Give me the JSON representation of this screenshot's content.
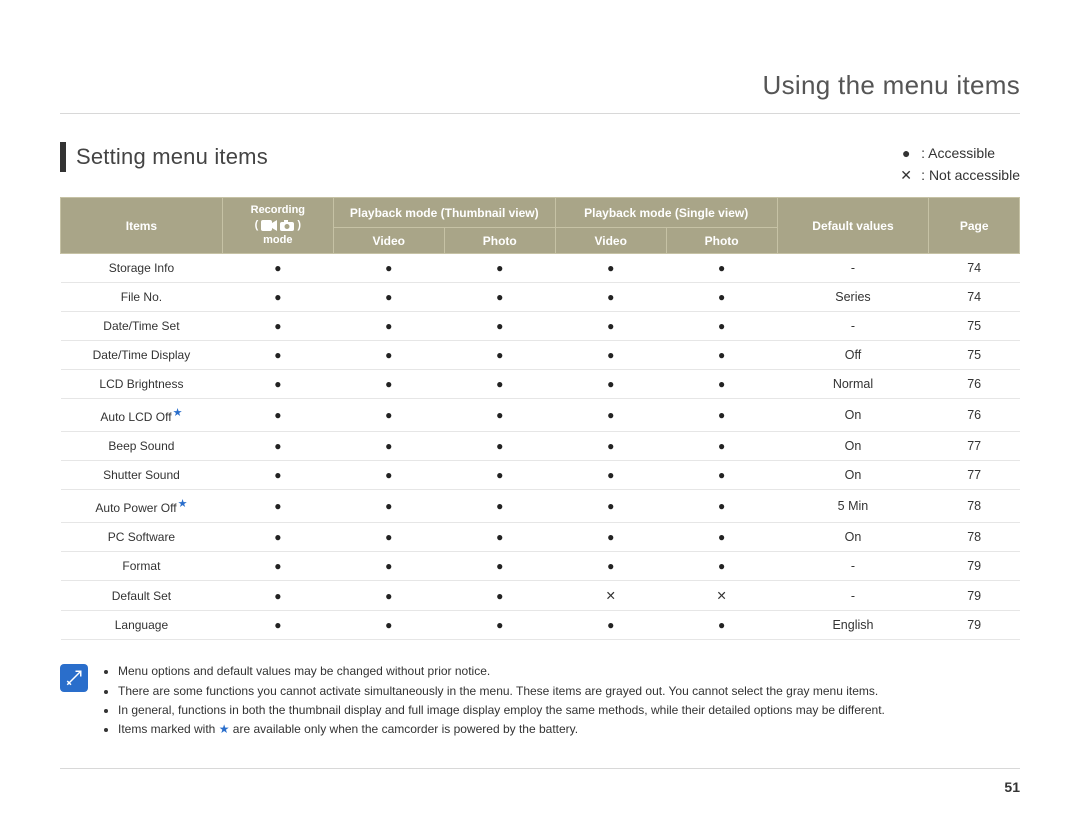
{
  "chapter_title": "Using the menu items",
  "section_title": "Setting menu items",
  "legend": {
    "accessible_symbol": "●",
    "accessible_label": ": Accessible",
    "not_accessible_symbol": "✕",
    "not_accessible_label": ": Not accessible"
  },
  "table": {
    "headers": {
      "items": "Items",
      "recording_top": "Recording",
      "recording_bottom": "mode",
      "pb_thumb": "Playback mode (Thumbnail view)",
      "pb_single": "Playback mode (Single view)",
      "video": "Video",
      "photo": "Photo",
      "default_values": "Default values",
      "page": "Page"
    },
    "rows": [
      {
        "item": "Storage Info",
        "star": false,
        "rec": "●",
        "tv": "●",
        "tp": "●",
        "sv": "●",
        "sp": "●",
        "def": "-",
        "page": "74"
      },
      {
        "item": "File No.",
        "star": false,
        "rec": "●",
        "tv": "●",
        "tp": "●",
        "sv": "●",
        "sp": "●",
        "def": "Series",
        "page": "74"
      },
      {
        "item": "Date/Time Set",
        "star": false,
        "rec": "●",
        "tv": "●",
        "tp": "●",
        "sv": "●",
        "sp": "●",
        "def": "-",
        "page": "75"
      },
      {
        "item": "Date/Time Display",
        "star": false,
        "rec": "●",
        "tv": "●",
        "tp": "●",
        "sv": "●",
        "sp": "●",
        "def": "Off",
        "page": "75"
      },
      {
        "item": "LCD Brightness",
        "star": false,
        "rec": "●",
        "tv": "●",
        "tp": "●",
        "sv": "●",
        "sp": "●",
        "def": "Normal",
        "page": "76"
      },
      {
        "item": "Auto LCD Off",
        "star": true,
        "rec": "●",
        "tv": "●",
        "tp": "●",
        "sv": "●",
        "sp": "●",
        "def": "On",
        "page": "76"
      },
      {
        "item": "Beep Sound",
        "star": false,
        "rec": "●",
        "tv": "●",
        "tp": "●",
        "sv": "●",
        "sp": "●",
        "def": "On",
        "page": "77"
      },
      {
        "item": "Shutter Sound",
        "star": false,
        "rec": "●",
        "tv": "●",
        "tp": "●",
        "sv": "●",
        "sp": "●",
        "def": "On",
        "page": "77"
      },
      {
        "item": "Auto Power Off",
        "star": true,
        "rec": "●",
        "tv": "●",
        "tp": "●",
        "sv": "●",
        "sp": "●",
        "def": "5 Min",
        "page": "78"
      },
      {
        "item": "PC Software",
        "star": false,
        "rec": "●",
        "tv": "●",
        "tp": "●",
        "sv": "●",
        "sp": "●",
        "def": "On",
        "page": "78"
      },
      {
        "item": "Format",
        "star": false,
        "rec": "●",
        "tv": "●",
        "tp": "●",
        "sv": "●",
        "sp": "●",
        "def": "-",
        "page": "79"
      },
      {
        "item": "Default Set",
        "star": false,
        "rec": "●",
        "tv": "●",
        "tp": "●",
        "sv": "✕",
        "sp": "✕",
        "def": "-",
        "page": "79"
      },
      {
        "item": "Language",
        "star": false,
        "rec": "●",
        "tv": "●",
        "tp": "●",
        "sv": "●",
        "sp": "●",
        "def": "English",
        "page": "79"
      }
    ]
  },
  "notes": {
    "n1": "Menu options and default values may be changed without prior notice.",
    "n2": "There are some functions you cannot activate simultaneously in the menu. These items are grayed out. You cannot select the gray menu items.",
    "n3": "In general, functions in both the thumbnail display and full image display employ the same methods, while their detailed options may be different.",
    "n4_a": "Items marked with ",
    "n4_b": " are available only when the camcorder is powered by the battery.",
    "star": "★"
  },
  "page_number": "51"
}
